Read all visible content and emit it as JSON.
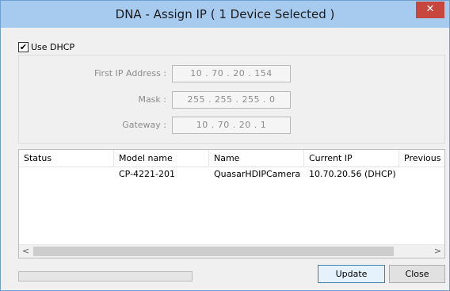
{
  "window": {
    "title": "DNA - Assign IP ( 1 Device Selected )",
    "close_glyph": "✕",
    "accent_color": "#a7cbef"
  },
  "dhcp": {
    "checked": true,
    "check_glyph": "✔",
    "label": "Use DHCP"
  },
  "ip_settings": {
    "first_ip": {
      "label": "First IP Address :",
      "value": "10  .  70  .  20  .  154"
    },
    "mask": {
      "label": "Mask :",
      "value": "255  .  255  .  255  .  0"
    },
    "gateway": {
      "label": "Gateway :",
      "value": "10  .  70  .  20  .  1"
    }
  },
  "device_list": {
    "columns": [
      "Status",
      "Model name",
      "Name",
      "Current IP",
      "Previous IP"
    ],
    "rows": [
      {
        "status": "",
        "model_name": "CP-4221-201",
        "name": "QuasarHDIPCamera",
        "current_ip": "10.70.20.56 (DHCP)",
        "previous_ip": ""
      }
    ],
    "scroll_left_glyph": "<",
    "scroll_right_glyph": ">"
  },
  "progress": {
    "value": 0
  },
  "buttons": {
    "update": "Update",
    "close": "Close"
  }
}
